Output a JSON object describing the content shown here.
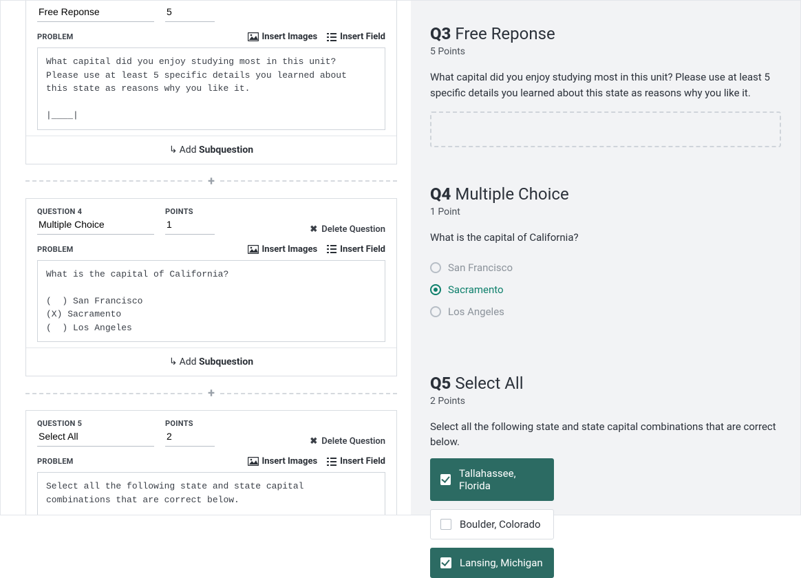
{
  "ui": {
    "question_label": "QUESTION",
    "points_label": "POINTS",
    "problem_label": "PROBLEM",
    "delete_question": "Delete Question",
    "insert_images": "Insert Images",
    "insert_field": "Insert Field",
    "add_subquestion_prefix": "Add ",
    "add_subquestion_bold": "Subquestion"
  },
  "editor": {
    "q3": {
      "title": "Free Reponse",
      "points": "5",
      "problem": "What capital did you enjoy studying most in this unit?\nPlease use at least 5 specific details you learned about\nthis state as reasons why you like it.\n\n|____|"
    },
    "q4": {
      "number": "QUESTION 4",
      "title": "Multiple Choice",
      "points": "1",
      "problem": "What is the capital of California?\n\n(  ) San Francisco\n(X) Sacramento\n(  ) Los Angeles"
    },
    "q5": {
      "number": "QUESTION 5",
      "title": "Select All",
      "points": "2",
      "problem": "Select all the following state and state capital\ncombinations that are correct below.\n\n[X] Tallahassee, Florida\n[ ] Boulder, Colorado\n[X] Lansing, Michigan"
    }
  },
  "preview": {
    "q3": {
      "num": "Q3",
      "title": "Free Reponse",
      "points": "5 Points",
      "text": "What capital did you enjoy studying most in this unit? Please use at least 5 specific details you learned about this state as reasons why you like it."
    },
    "q4": {
      "num": "Q4",
      "title": "Multiple Choice",
      "points": "1 Point",
      "text": "What is the capital of California?",
      "opts": {
        "a": "San Francisco",
        "b": "Sacramento",
        "c": "Los Angeles"
      }
    },
    "q5": {
      "num": "Q5",
      "title": "Select All",
      "points": "2 Points",
      "text": "Select all the following state and state capital combinations that are correct below.",
      "opts": {
        "a": "Tallahassee, Florida",
        "b": "Boulder, Colorado",
        "c": "Lansing, Michigan"
      }
    }
  }
}
